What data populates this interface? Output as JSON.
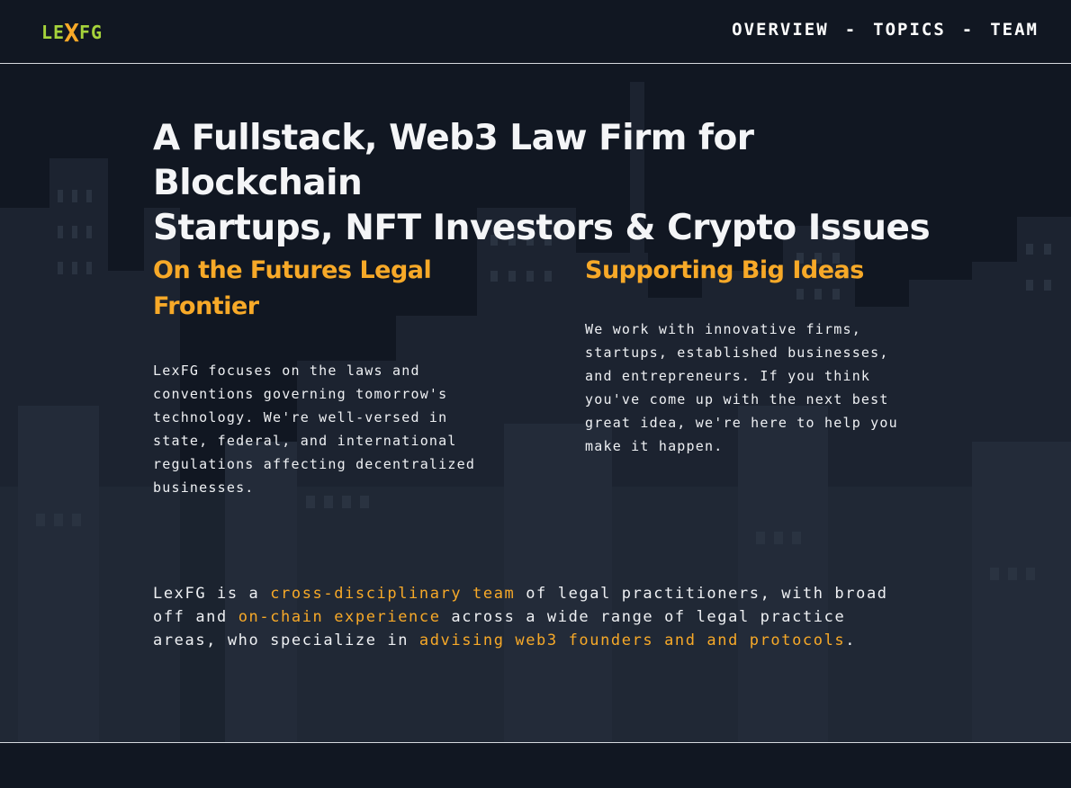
{
  "header": {
    "logo": {
      "part1": "LE",
      "part2": "X",
      "part3": "FG"
    },
    "nav": [
      {
        "label": "OVERVIEW",
        "active": true
      },
      {
        "label": "TOPICS",
        "active": false
      },
      {
        "label": "TEAM",
        "active": false
      }
    ],
    "separator": "-"
  },
  "hero": {
    "title_line1": "A Fullstack, Web3 Law Firm for Blockchain",
    "title_line2": "Startups, NFT Investors & Crypto Issues"
  },
  "columns": [
    {
      "heading": "On the Futures Legal Frontier",
      "body": "LexFG focuses on the laws and conventions governing tomorrow's technology. We're well-versed in state, federal, and international regulations affecting decentralized businesses."
    },
    {
      "heading": "Supporting Big Ideas",
      "body": "We work with innovative firms, startups, established businesses, and entrepreneurs. If you think you've come up with the next best great idea, we're here to help you make it happen."
    }
  ],
  "summary": {
    "t1": "LexFG is a ",
    "h1": "cross-disciplinary team",
    "t2": " of legal practitioners, with broad off and ",
    "h2": "on-chain experience",
    "t3": " across a wide range of legal practice areas, who specialize in ",
    "h3": "advising web3 founders and and protocols",
    "t4": "."
  },
  "colors": {
    "background": "#111722",
    "accent_orange": "#f7a928",
    "logo_green": "#a6d33b",
    "text": "#f1f2f4"
  }
}
